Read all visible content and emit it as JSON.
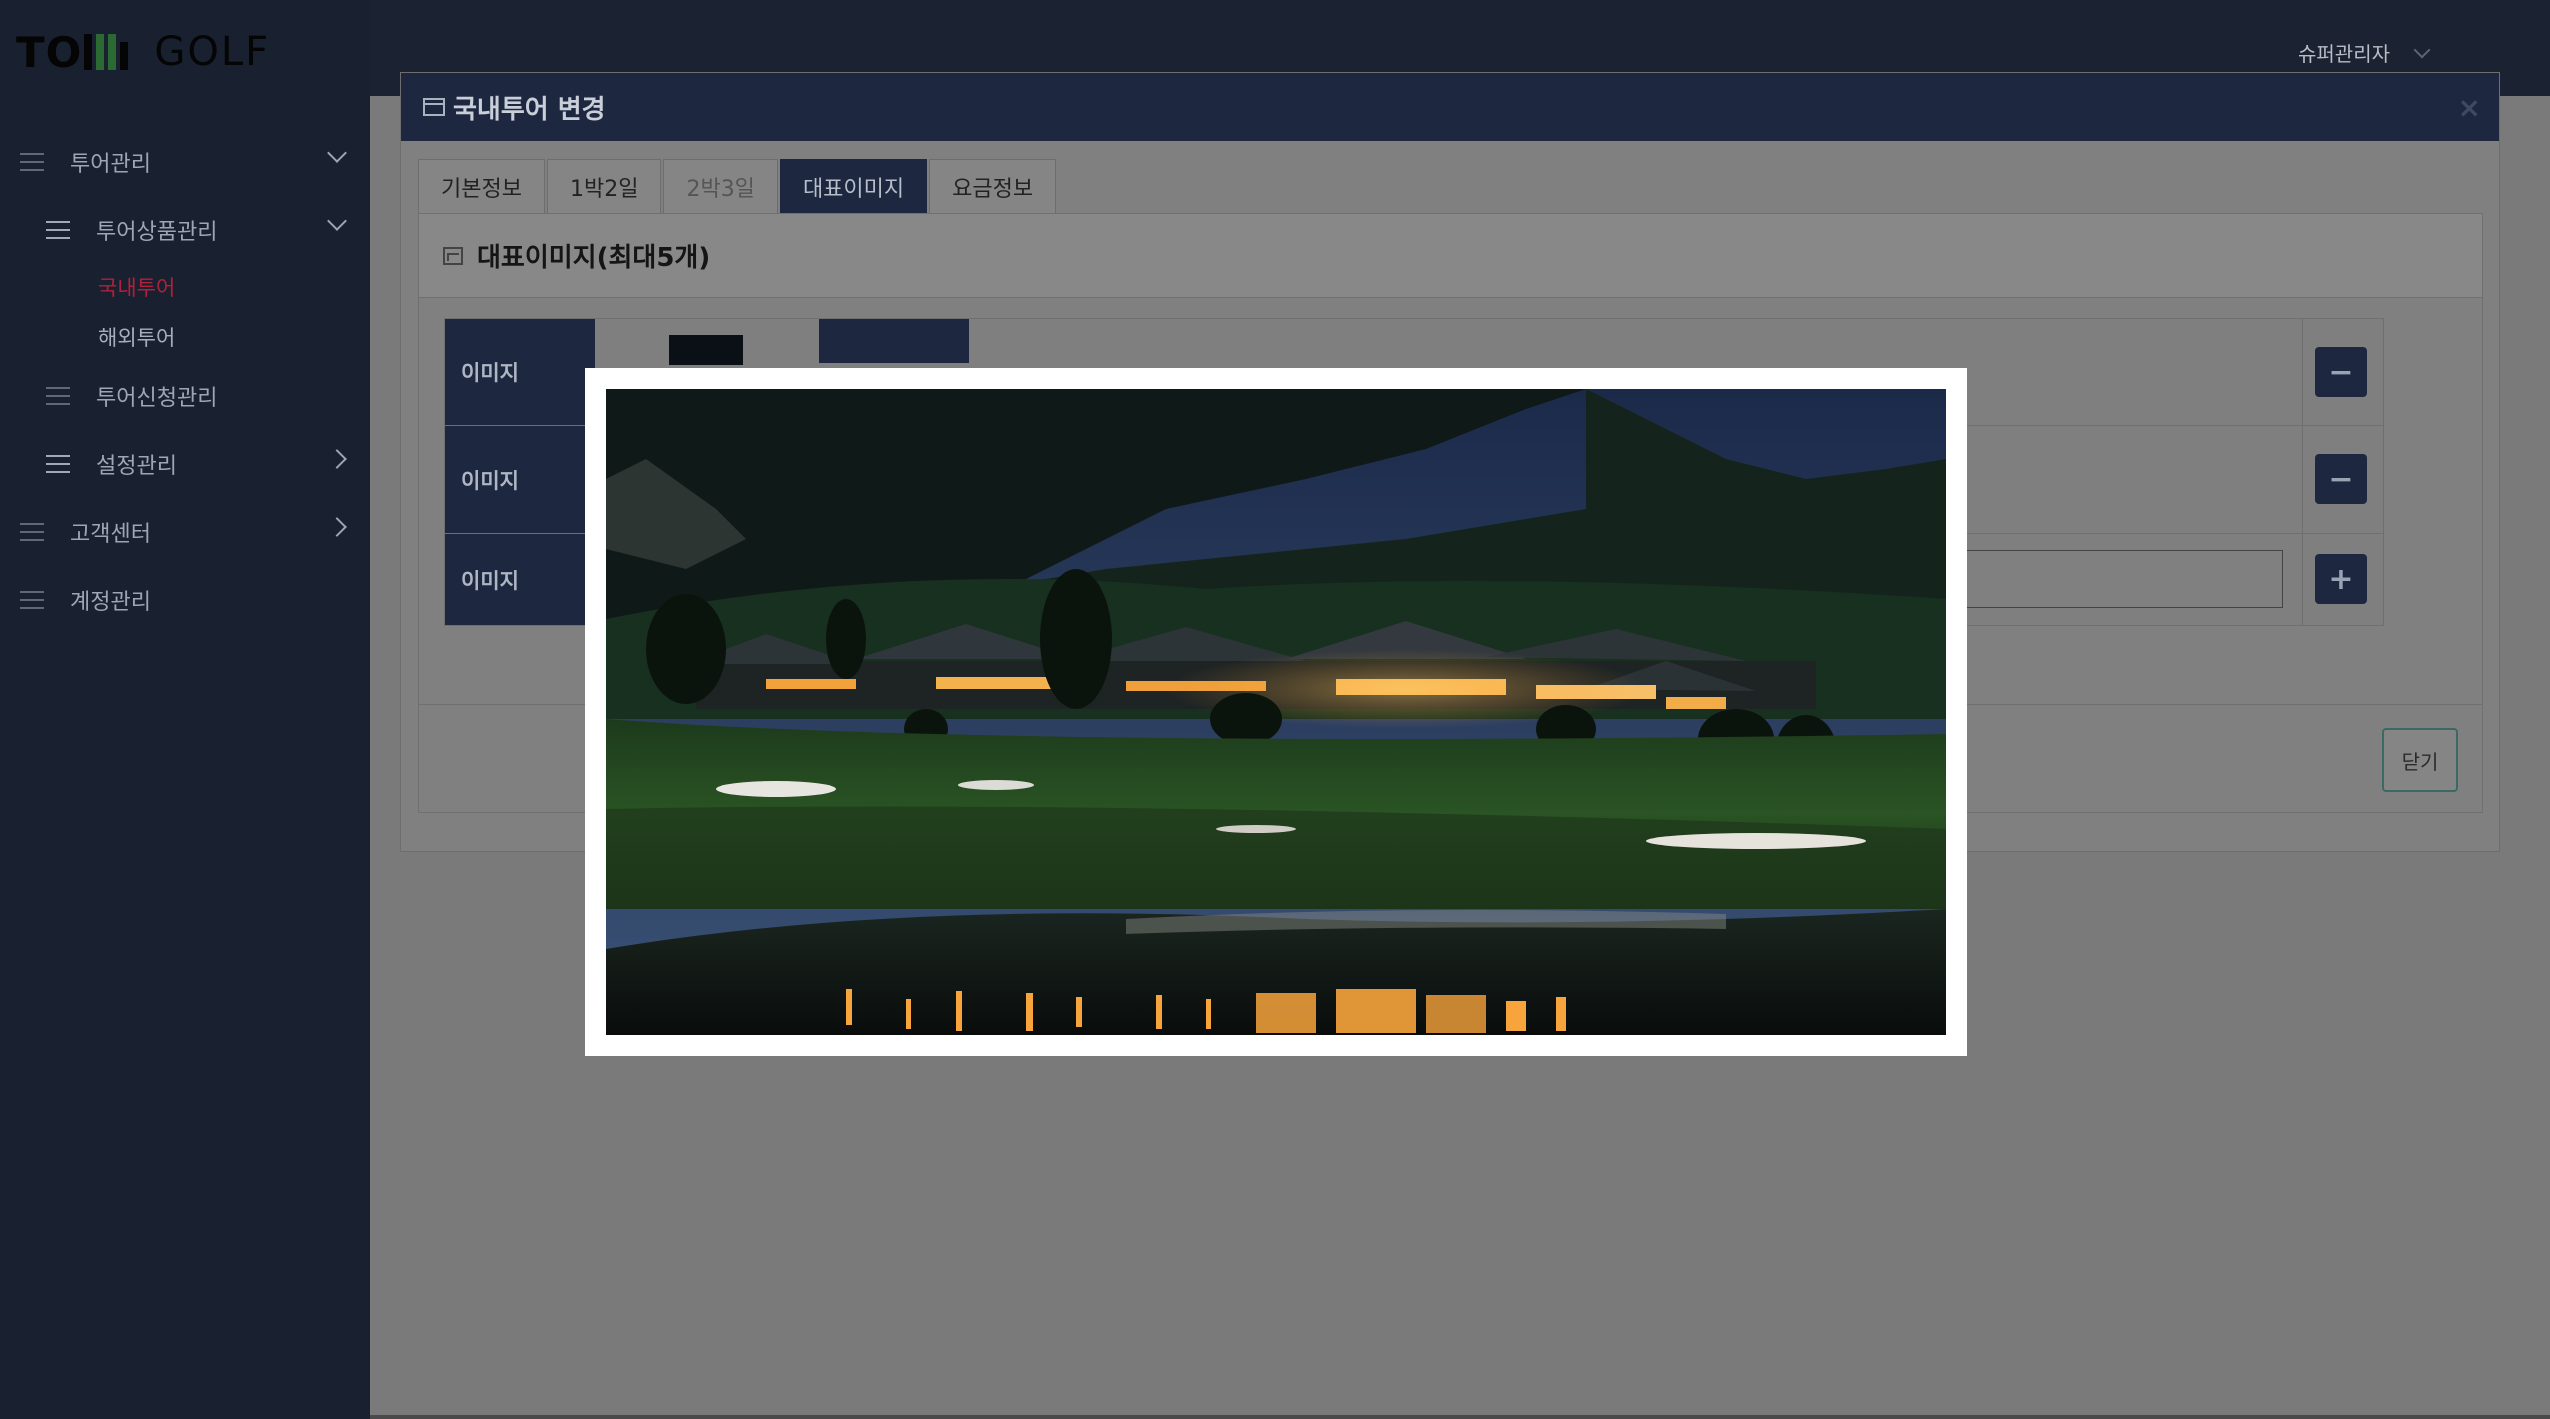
{
  "brand": {
    "logo_left": "TO",
    "logo_right": "GOLF"
  },
  "sidebar": {
    "items": [
      {
        "label": "투어관리"
      },
      {
        "label": "투어상품관리"
      },
      {
        "label": "국내투어"
      },
      {
        "label": "해외투어"
      },
      {
        "label": "투어신청관리"
      },
      {
        "label": "설정관리"
      },
      {
        "label": "고객센터"
      },
      {
        "label": "계정관리"
      }
    ]
  },
  "topbar": {
    "user_name": "슈퍼관리자"
  },
  "dialog": {
    "title": "국내투어 변경",
    "close_symbol": "×",
    "tabs": [
      {
        "label": "기본정보"
      },
      {
        "label": "1박2일"
      },
      {
        "label": "2박3일"
      },
      {
        "label": "대표이미지"
      },
      {
        "label": "요금정보"
      }
    ],
    "section_title": "대표이미지(최대5개)",
    "rows": [
      {
        "label": "이미지",
        "action": "−"
      },
      {
        "label": "이미지",
        "action": "−"
      },
      {
        "label": "이미지",
        "action": "+"
      }
    ],
    "close_label": "닫기"
  },
  "colors": {
    "sidebar_bg": "#19202f",
    "navy": "#1d2840",
    "active_leaf": "#b0213b"
  }
}
